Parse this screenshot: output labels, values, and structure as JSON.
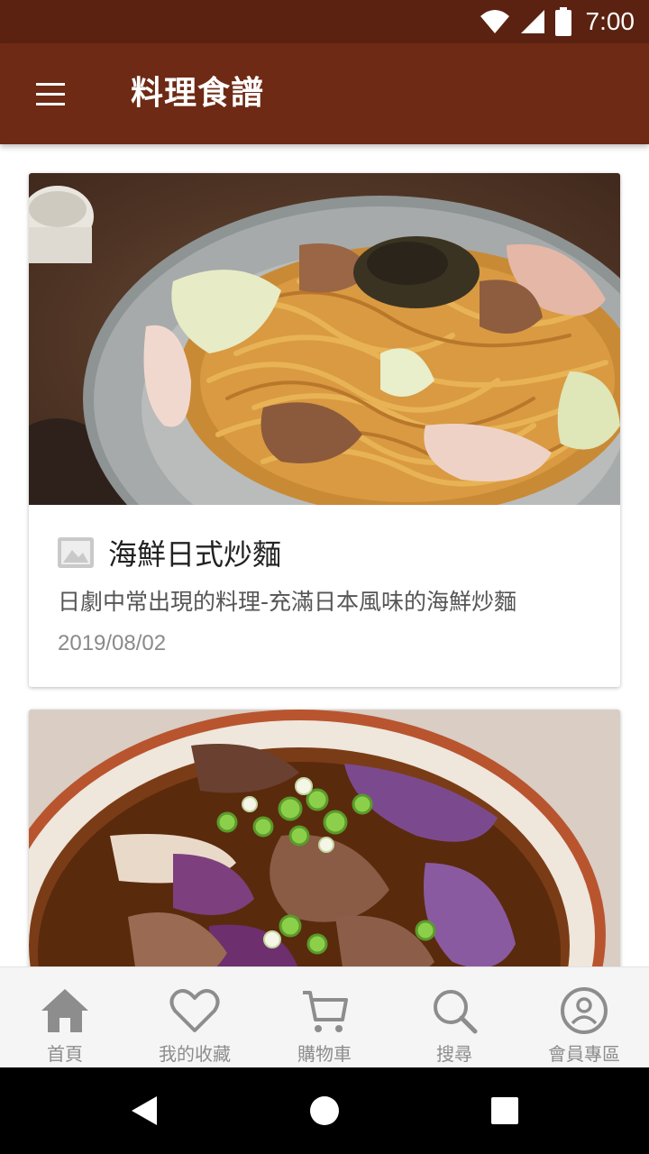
{
  "status_bar": {
    "time": "7:00",
    "icons": [
      "wifi-icon",
      "signal-icon",
      "battery-icon"
    ]
  },
  "app_bar": {
    "title": "料理食譜",
    "menu_icon": "hamburger-menu-icon",
    "background": "#6e2a14"
  },
  "recipes": [
    {
      "title": "海鮮日式炒麵",
      "description": "日劇中常出現的料理-充滿日本風味的海鮮炒麵",
      "date": "2019/08/02",
      "photo": "yakisoba-photo"
    },
    {
      "photo": "beef-eggplant-soup-photo"
    }
  ],
  "bottom_nav": {
    "active_color": "#8d8d8d",
    "items": [
      {
        "label": "首頁",
        "icon": "home-icon"
      },
      {
        "label": "我的收藏",
        "icon": "heart-icon"
      },
      {
        "label": "購物車",
        "icon": "cart-icon"
      },
      {
        "label": "搜尋",
        "icon": "search-icon"
      },
      {
        "label": "會員專區",
        "icon": "account-icon"
      }
    ]
  },
  "system_nav": [
    "back-icon",
    "home-circle-icon",
    "recents-icon"
  ]
}
